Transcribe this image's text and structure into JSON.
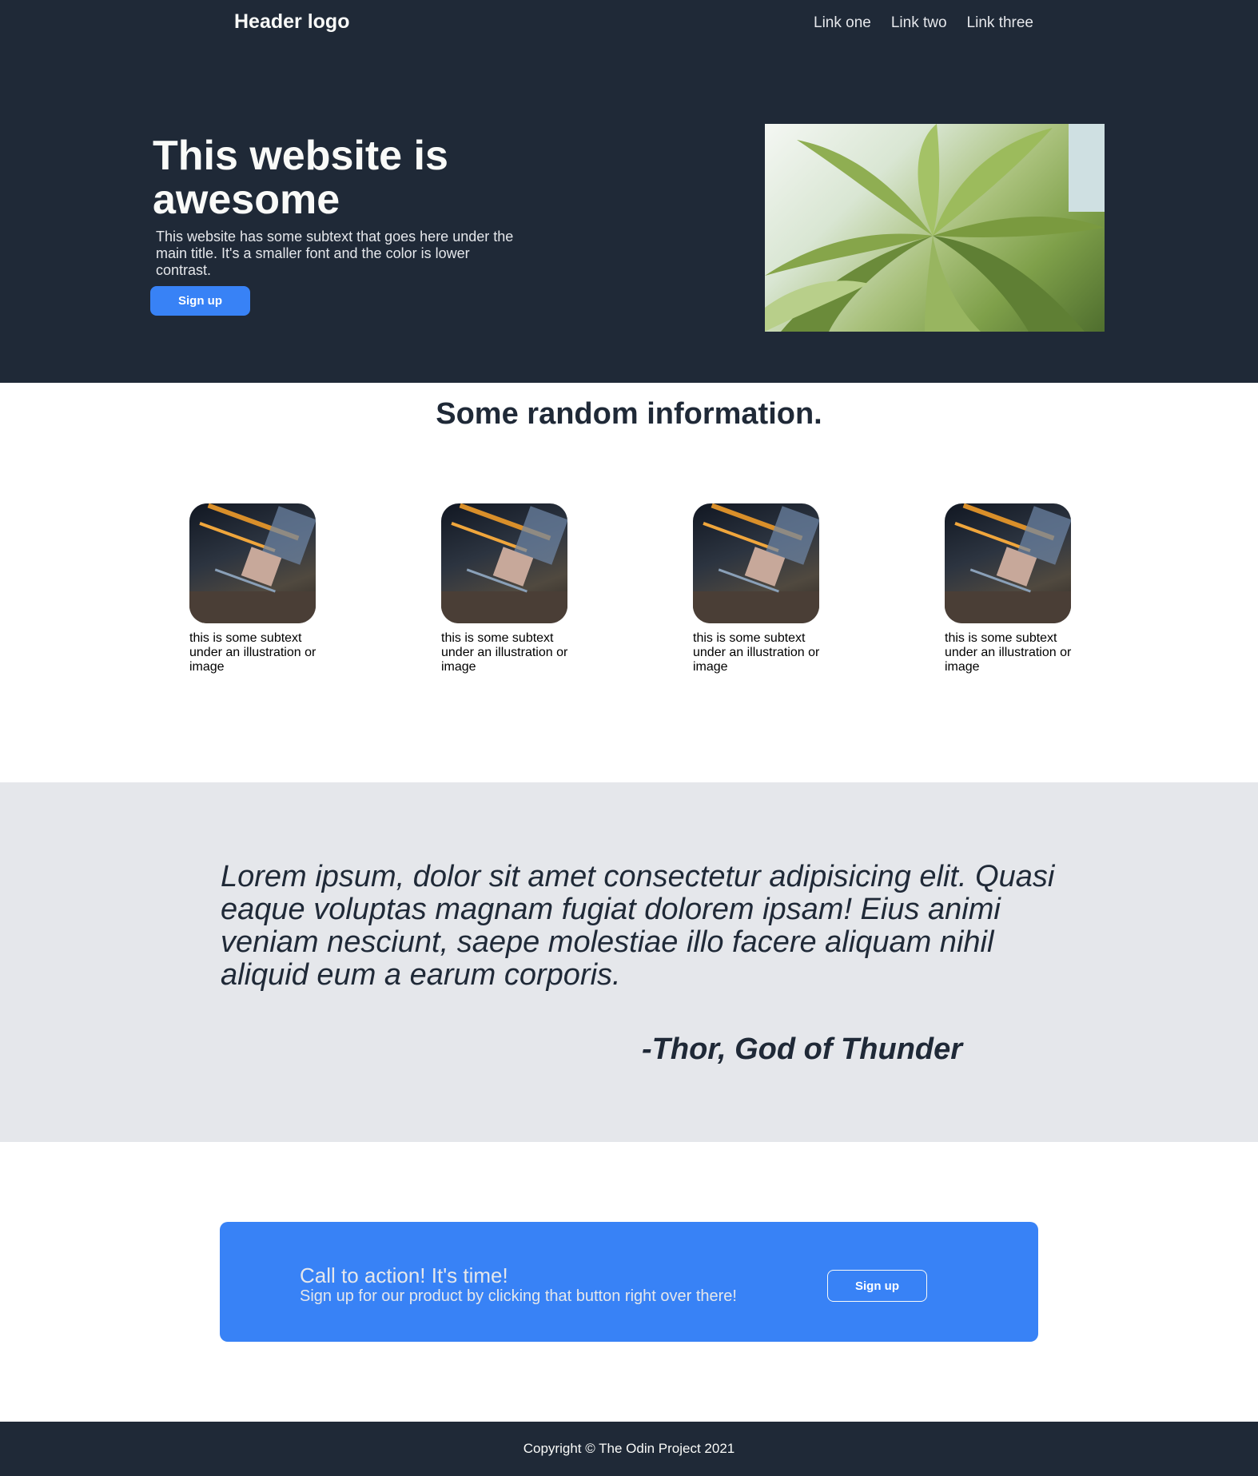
{
  "header": {
    "logo": "Header logo",
    "nav": [
      "Link one",
      "Link two",
      "Link three"
    ]
  },
  "hero": {
    "title": "This website is awesome",
    "subtext": "This website has some subtext that goes here under the main title. It's a smaller font and the color is lower contrast.",
    "button_label": "Sign up",
    "image_icon": "plant-leaves-photo"
  },
  "info": {
    "title": "Some random information.",
    "cards": [
      {
        "text": "this is some subtext under an illustration or image",
        "image_icon": "circuit-board-photo"
      },
      {
        "text": "this is some subtext under an illustration or image",
        "image_icon": "circuit-board-photo"
      },
      {
        "text": "this is some subtext under an illustration or image",
        "image_icon": "circuit-board-photo"
      },
      {
        "text": "this is some subtext under an illustration or image",
        "image_icon": "circuit-board-photo"
      }
    ]
  },
  "quote": {
    "text": "Lorem ipsum, dolor sit amet consectetur adipisicing elit. Quasi eaque voluptas magnam fugiat dolorem ipsam! Eius animi veniam nesciunt, saepe molestiae illo facere aliquam nihil aliquid eum a earum corporis.",
    "author": "-Thor, God of Thunder"
  },
  "cta": {
    "title": "Call to action! It's time!",
    "subtext": "Sign up for our product by clicking that button right over there!",
    "button_label": "Sign up"
  },
  "footer": {
    "copyright": "Copyright © The Odin Project 2021"
  },
  "colors": {
    "dark": "#1f2937",
    "accent_blue": "#3882f6",
    "light_gray": "#e5e7eb",
    "off_white": "#f9faf8"
  }
}
